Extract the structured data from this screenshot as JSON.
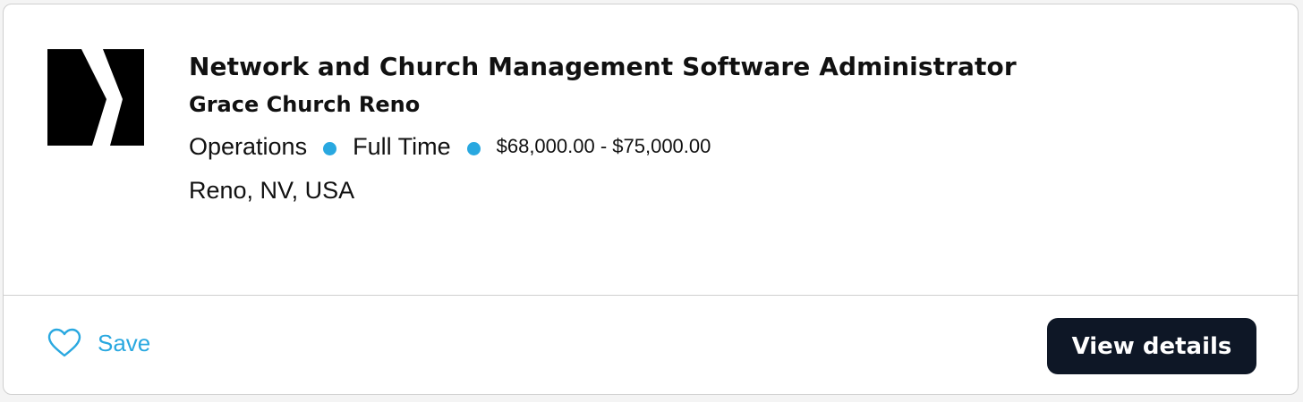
{
  "job": {
    "title": "Network and Church Management Software Administrator",
    "company": "Grace Church Reno",
    "department": "Operations",
    "employment_type": "Full Time",
    "salary": "$68,000.00 - $75,000.00",
    "location": "Reno, NV, USA",
    "logo_icon": "grace-church-chevron-logo"
  },
  "actions": {
    "save_label": "Save",
    "save_icon": "heart-outline-icon",
    "view_details_label": "View details"
  },
  "colors": {
    "accent": "#29a8e0",
    "button_bg": "#0e1726",
    "text": "#111111",
    "border": "#cfcfcf"
  }
}
